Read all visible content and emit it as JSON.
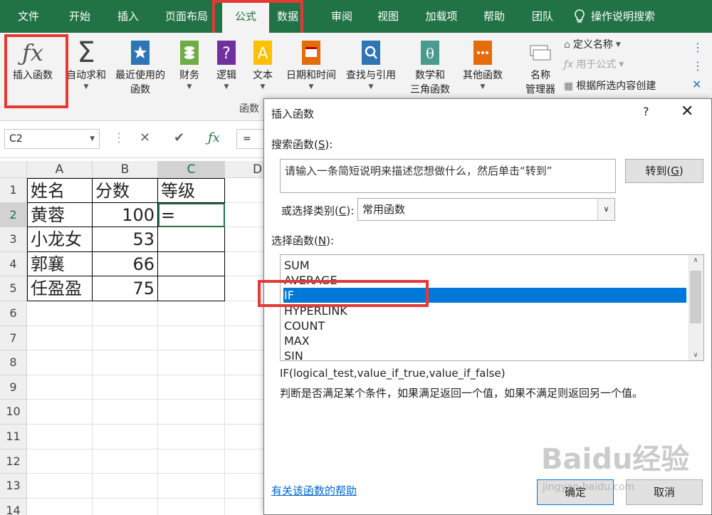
{
  "tabs": [
    "文件",
    "开始",
    "插入",
    "页面布局",
    "公式",
    "数据",
    "审阅",
    "视图",
    "加载项",
    "帮助",
    "团队",
    "操作说明搜索"
  ],
  "ribbon": {
    "insert_function": "插入函数",
    "autosum": "自动求和",
    "recent_line1": "最近使用的",
    "recent_line2": "函数",
    "financial": "财务",
    "logical": "逻辑",
    "text": "文本",
    "datetime": "日期和时间",
    "lookup": "查找与引用",
    "math_line1": "数学和",
    "math_line2": "三角函数",
    "other": "其他函数",
    "name_mgr_line1": "名称",
    "name_mgr_line2": "管理器",
    "define_name": "定义名称",
    "use_in_formula": "用于公式",
    "create_from_sel": "根据所选内容创建",
    "group_label": "函数"
  },
  "formula_bar": {
    "name_box": "C2",
    "formula": "="
  },
  "grid": {
    "columns": [
      "A",
      "B",
      "C",
      "D"
    ],
    "rows": [
      "1",
      "2",
      "3",
      "4",
      "5",
      "6",
      "7",
      "8",
      "9",
      "10",
      "11",
      "12",
      "13",
      "14"
    ],
    "cells": [
      [
        "姓名",
        "分数",
        "等级"
      ],
      [
        "黄蓉",
        "100",
        "="
      ],
      [
        "小龙女",
        "53",
        ""
      ],
      [
        "郭襄",
        "66",
        ""
      ],
      [
        "任盈盈",
        "75",
        ""
      ]
    ]
  },
  "dialog": {
    "title": "插入函数",
    "help": "?",
    "close": "✕",
    "search_label": "搜索函数(",
    "search_key": "S",
    "search_suffix": "):",
    "search_text": "请输入一条简短说明来描述您想做什么，然后单击“转到”",
    "go_button_main": "转到(",
    "go_button_key": "G",
    "go_button_suffix": ")",
    "category_label": "或选择类别(",
    "category_key": "C",
    "category_suffix": "):",
    "category_value": "常用函数",
    "select_label": "选择函数(",
    "select_key": "N",
    "select_suffix": "):",
    "functions": [
      "SUM",
      "AVERAGE",
      "IF",
      "HYPERLINK",
      "COUNT",
      "MAX",
      "SIN"
    ],
    "selected_index": 2,
    "syntax": "IF(logical_test,value_if_true,value_if_false)",
    "description": "判断是否满足某个条件，如果满足返回一个值，如果不满足则返回另一个值。",
    "help_link": "有关该函数的帮助",
    "ok": "确定",
    "cancel": "取消"
  },
  "watermark": {
    "main": "Baidu经验",
    "sub": "jingyan.baidu.com"
  },
  "colors": {
    "excel_green": "#217346",
    "highlight_red": "#e53935",
    "selection_blue": "#0078d7"
  }
}
